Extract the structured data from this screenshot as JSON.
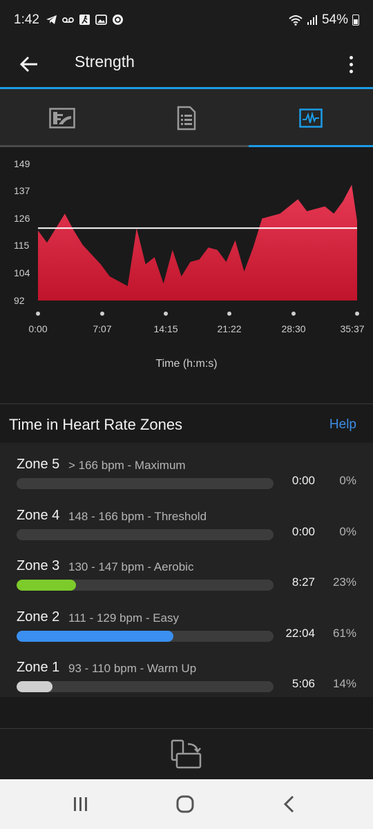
{
  "status": {
    "time": "1:42",
    "battery": "54%",
    "icons_left": [
      "telegram-icon",
      "voicemail-icon",
      "run-icon",
      "gallery-icon",
      "sync-icon"
    ],
    "icons_right": [
      "wifi-icon",
      "signal-icon",
      "battery-icon"
    ]
  },
  "appbar": {
    "title": "Strength"
  },
  "tabs": [
    {
      "icon": "stats-icon",
      "active": false
    },
    {
      "icon": "details-icon",
      "active": false
    },
    {
      "icon": "heart-rate-chart-icon",
      "active": true
    }
  ],
  "chart_data": {
    "type": "area",
    "ylabels": [
      "149",
      "137",
      "126",
      "115",
      "104",
      "92"
    ],
    "yticks": [
      149,
      137,
      126,
      115,
      104,
      92
    ],
    "ylim": [
      92,
      149
    ],
    "xlabels": [
      "0:00",
      "7:07",
      "14:15",
      "21:22",
      "28:30",
      "35:37"
    ],
    "xlabel": "Time (h:m:s)",
    "average": 122,
    "fill_color_top": "#e83a55",
    "fill_color_bottom": "#c0142c",
    "x": [
      0,
      1,
      2,
      3,
      4,
      5,
      6,
      7,
      8,
      9,
      10,
      11,
      12,
      13,
      14,
      15,
      16,
      17,
      18,
      19,
      20,
      21,
      22,
      23,
      24,
      25,
      26,
      27,
      28,
      29,
      30,
      31,
      32,
      33,
      34,
      35,
      35.6
    ],
    "values": [
      121,
      116,
      122,
      128,
      121,
      115,
      111,
      107,
      102,
      100,
      98,
      122,
      107,
      110,
      99,
      113,
      102,
      108,
      109,
      114,
      113,
      108,
      117,
      104,
      114,
      126,
      127,
      128,
      131,
      134,
      129,
      130,
      131,
      128,
      133,
      140,
      125
    ]
  },
  "zones_section": {
    "title": "Time in Heart Rate Zones",
    "help": "Help"
  },
  "zones": [
    {
      "name": "Zone 5",
      "range": "> 166 bpm - Maximum",
      "time": "0:00",
      "pct": "0%",
      "fraction": 0,
      "color": "#7ccb2b"
    },
    {
      "name": "Zone 4",
      "range": "148 - 166 bpm - Threshold",
      "time": "0:00",
      "pct": "0%",
      "fraction": 0,
      "color": "#7ccb2b"
    },
    {
      "name": "Zone 3",
      "range": "130 - 147 bpm - Aerobic",
      "time": "8:27",
      "pct": "23%",
      "fraction": 0.23,
      "color": "#7ccb2b"
    },
    {
      "name": "Zone 2",
      "range": "111 - 129 bpm - Easy",
      "time": "22:04",
      "pct": "61%",
      "fraction": 0.61,
      "color": "#3a8ff0"
    },
    {
      "name": "Zone 1",
      "range": "93 - 110 bpm - Warm Up",
      "time": "5:06",
      "pct": "14%",
      "fraction": 0.14,
      "color": "#cfcfcf"
    }
  ],
  "bottom": {
    "icon": "rotate-screen-icon"
  },
  "navbar": {
    "icons": [
      "recent-apps-icon",
      "home-icon",
      "back-nav-icon"
    ]
  }
}
